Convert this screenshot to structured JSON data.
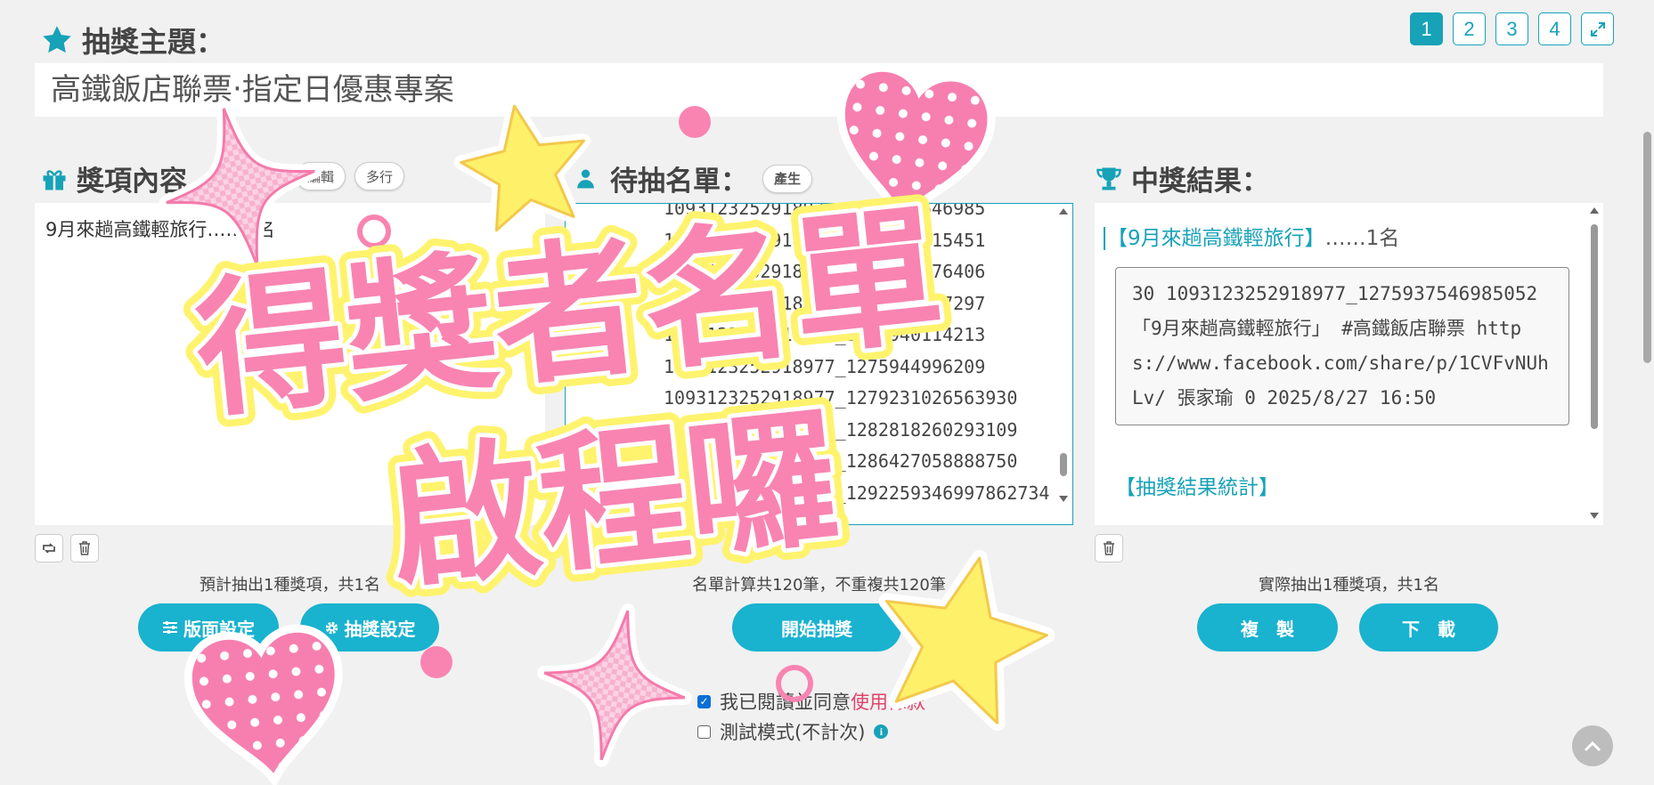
{
  "header": {
    "title_label": "抽獎主題：",
    "title_value": "高鐵飯店聯票‧指定日優惠專案",
    "pages": [
      "1",
      "2",
      "3",
      "4"
    ],
    "active_page": "1"
  },
  "prizes": {
    "heading": "獎項內容",
    "chip_edit": "編輯",
    "chip_multiline": "多行",
    "content": "9月來趟高鐵輕旅行……1名",
    "summary": "預計抽出1種獎項，共1名"
  },
  "candidates": {
    "heading": "待抽名單：",
    "chip_generate": "產生",
    "lines": [
      "1093123252918977_1275937546985",
      "1093123252918977_1275938015451",
      "1093123252918977_1275938576406",
      "1093123252918977_1275938747297",
      "1093123252918977_1275940114213",
      "1093123252918977_1275944996209",
      "1093123252918977_1279231026563930",
      "1093123252918977_1282818260293109",
      "1093123252918977_1286427058888750",
      "1093123252918977_1292259346997862734"
    ],
    "summary": "名單計算共120筆，不重複共120筆"
  },
  "results": {
    "heading": "中獎結果：",
    "prize_line_name": "【9月來趟高鐵輕旅行】",
    "prize_line_count": "……1名",
    "winner_record": "30 1093123252918977_1275937546985052 「9月來趟高鐵輕旅行」 #高鐵飯店聯票 https://www.facebook.com/share/p/1CVFvNUhLv/ 張家瑜 0 2025/8/27 16:50",
    "stats_heading": "【抽獎結果統計】",
    "summary": "實際抽出1種獎項，共1名"
  },
  "buttons": {
    "layout_settings": "版面設定",
    "draw_settings": "抽獎設定",
    "start_draw": "開始抽獎",
    "copy": "複　製",
    "download": "下　載"
  },
  "options": {
    "agree_text": "我已閱讀並同意",
    "agree_link": "使用條款",
    "agree_checked": true,
    "test_mode": "測試模式(不計次)",
    "test_checked": false
  },
  "overlay": {
    "line1": "得獎者名單",
    "line2": "啟程囉"
  },
  "colors": {
    "accent": "#17a2b8",
    "button": "#19b2cf",
    "overlay_pink": "#f984b1",
    "overlay_yellow": "#fff36e"
  }
}
